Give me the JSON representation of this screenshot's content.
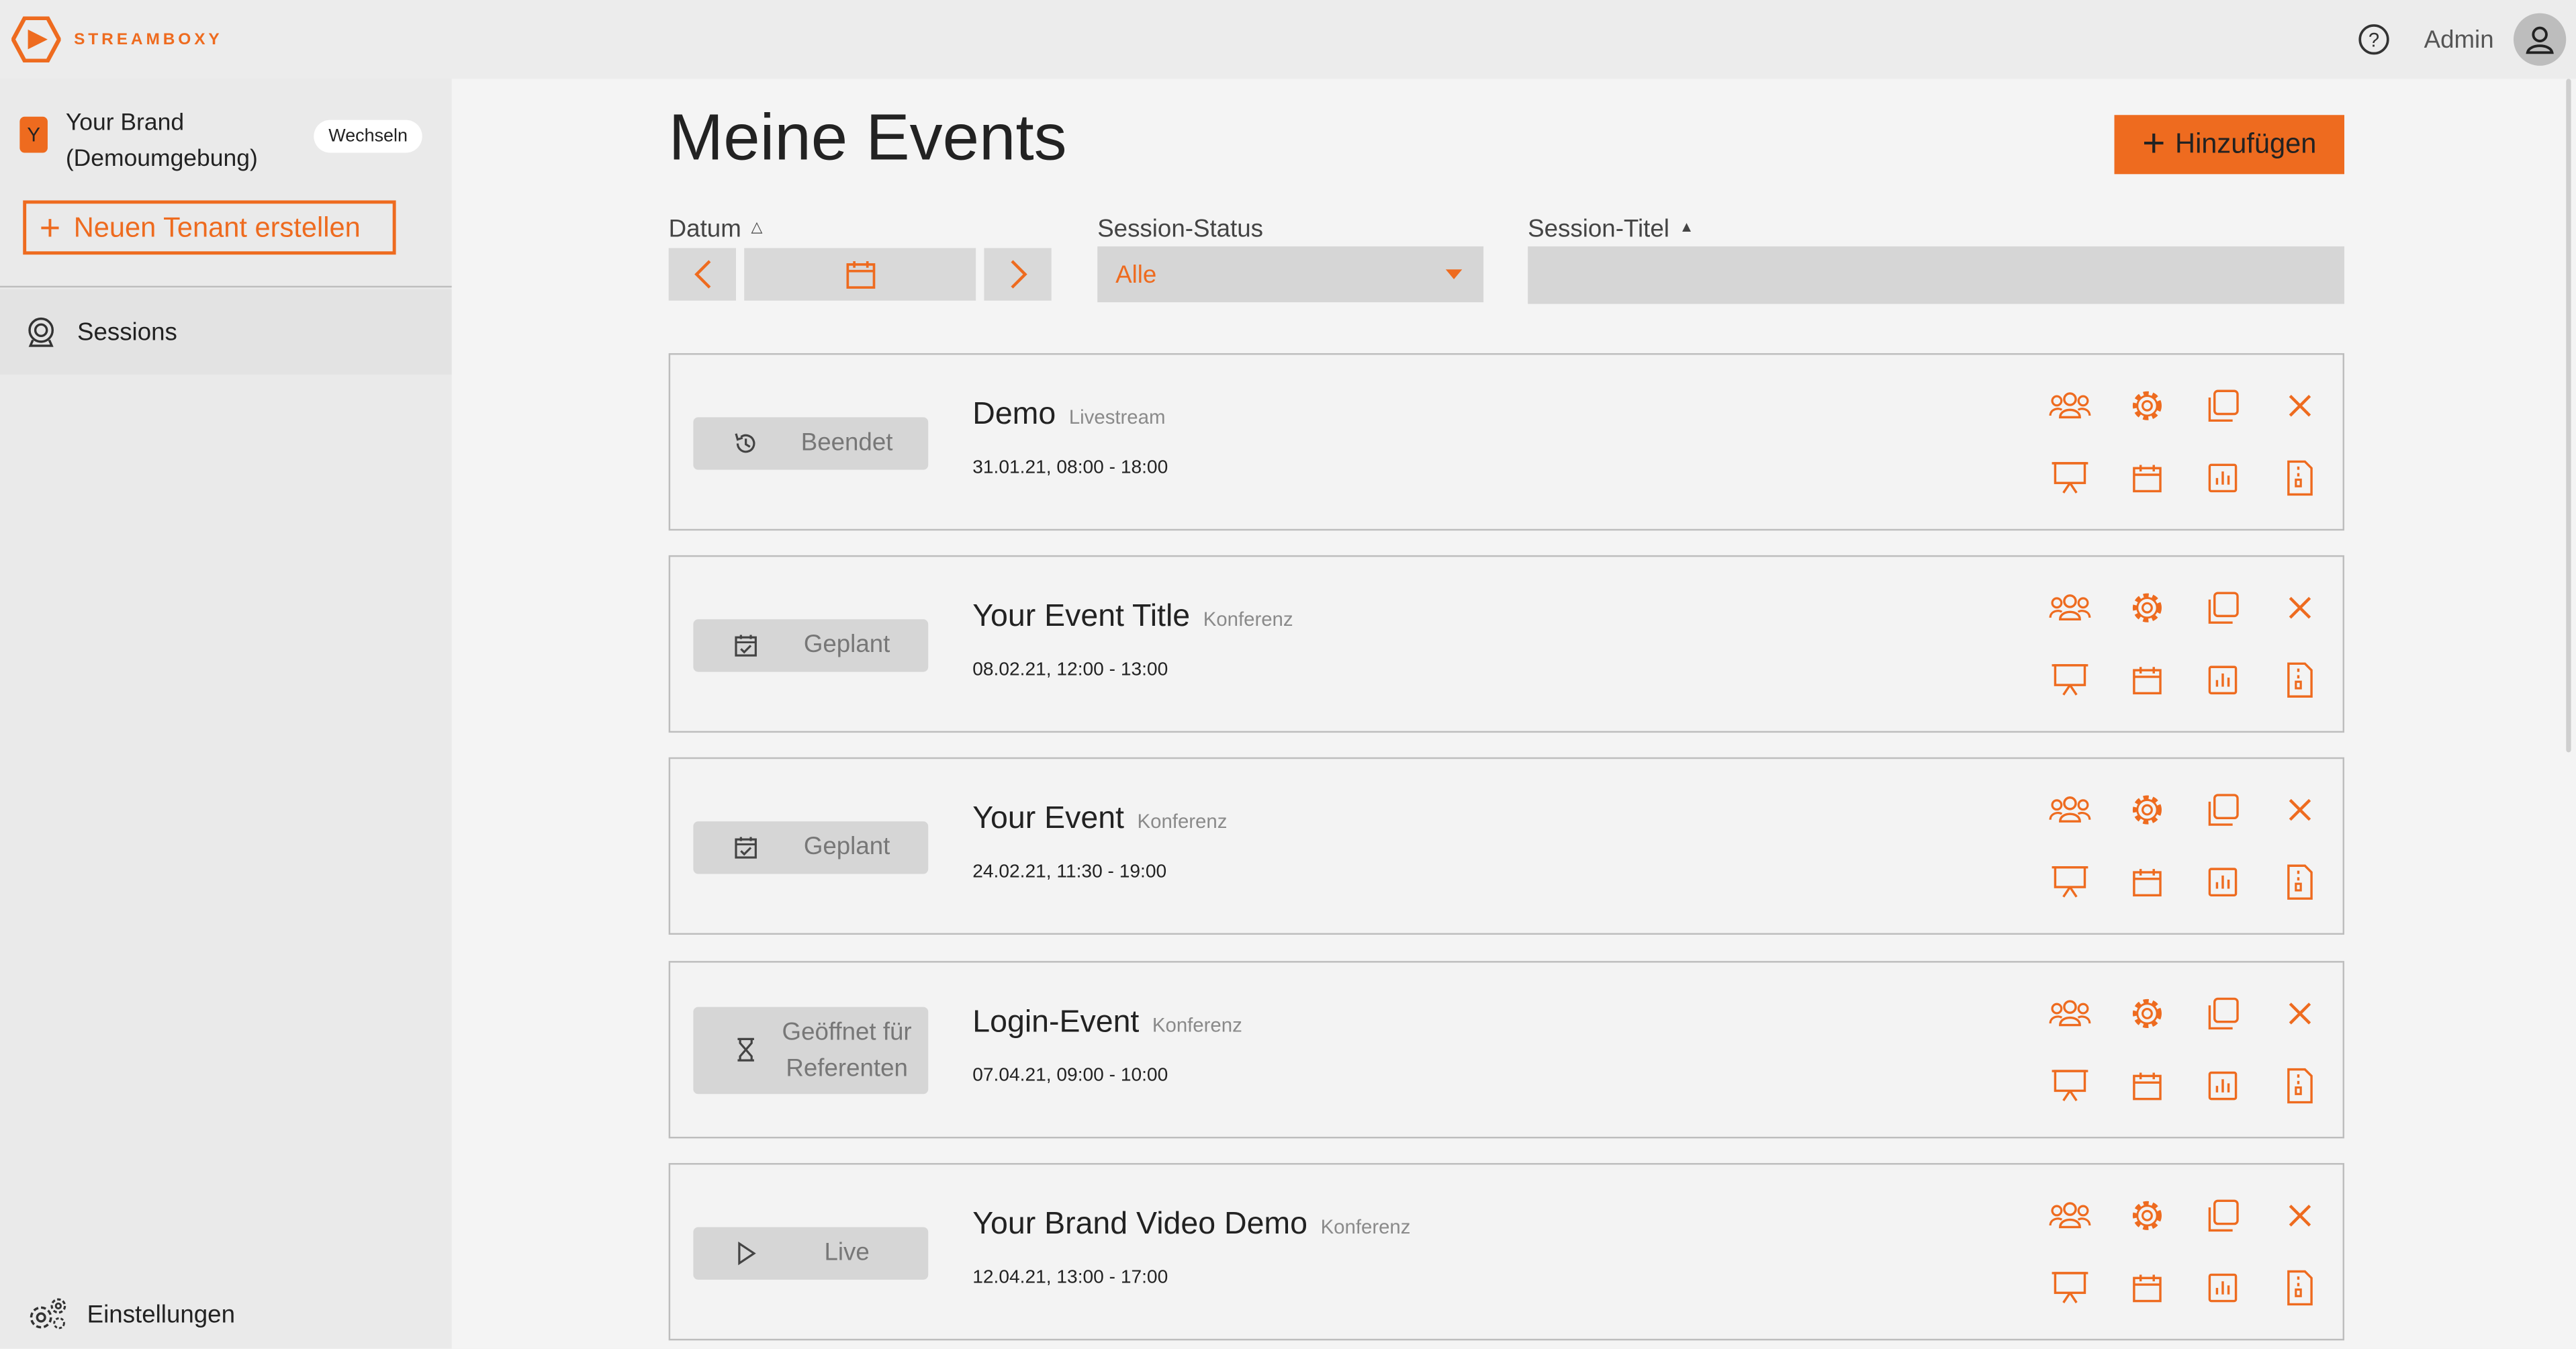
{
  "app": {
    "brand": "STREAMBOXY",
    "user": "Admin",
    "accent": "#ee6b1f"
  },
  "sidebar": {
    "tenant_initial": "Y",
    "tenant_name": "Your Brand (Demoumgebung)",
    "switch_label": "Wechseln",
    "new_tenant_label": "Neuen Tenant erstellen",
    "nav": [
      {
        "label": "Sessions",
        "icon": "webcam-icon"
      }
    ],
    "settings_label": "Einstellungen"
  },
  "main": {
    "title": "Meine Events",
    "add_label": "Hinzufügen",
    "filters": {
      "date_label": "Datum",
      "status_label": "Session-Status",
      "status_value": "Alle",
      "title_label": "Session-Titel",
      "title_value": ""
    },
    "events": [
      {
        "status": "Beendet",
        "status_icon": "history-icon",
        "title": "Demo",
        "type": "Livestream",
        "date": "31.01.21, 08:00 - 18:00"
      },
      {
        "status": "Geplant",
        "status_icon": "calendar-check-icon",
        "title": "Your Event Title",
        "type": "Konferenz",
        "date": "08.02.21, 12:00 - 13:00"
      },
      {
        "status": "Geplant",
        "status_icon": "calendar-check-icon",
        "title": "Your Event",
        "type": "Konferenz",
        "date": "24.02.21, 11:30 - 19:00"
      },
      {
        "status": "Geöffnet für Referenten",
        "status_icon": "hourglass-icon",
        "title": "Login-Event",
        "type": "Konferenz",
        "date": "07.04.21, 09:00 - 10:00"
      },
      {
        "status": "Live",
        "status_icon": "play-icon",
        "title": "Your Brand Video Demo",
        "type": "Konferenz",
        "date": "12.04.21, 13:00 - 17:00"
      }
    ]
  }
}
